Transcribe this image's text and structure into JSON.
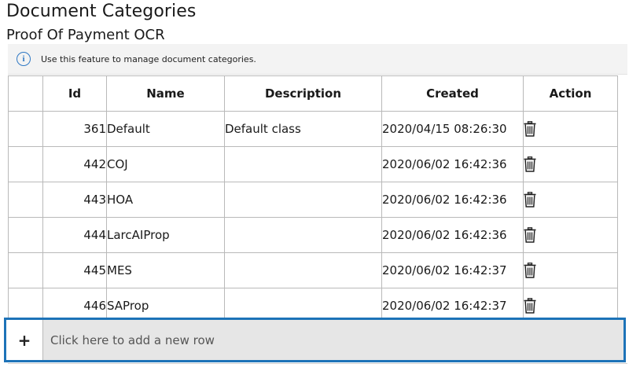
{
  "page": {
    "title": "Document Categories",
    "subtitle": "Proof Of Payment OCR"
  },
  "info": {
    "icon": "info-icon",
    "text": "Use this feature to manage document categories."
  },
  "table": {
    "columns": [
      "",
      "Id",
      "Name",
      "Description",
      "Created",
      "Action"
    ],
    "rows": [
      {
        "id": "361",
        "name": "Default",
        "description": "Default class",
        "created": "2020/04/15 08:26:30",
        "action_icon": "trash-icon"
      },
      {
        "id": "442",
        "name": "COJ",
        "description": "",
        "created": "2020/06/02 16:42:36",
        "action_icon": "trash-icon"
      },
      {
        "id": "443",
        "name": "HOA",
        "description": "",
        "created": "2020/06/02 16:42:36",
        "action_icon": "trash-icon"
      },
      {
        "id": "444",
        "name": "LarcAIProp",
        "description": "",
        "created": "2020/06/02 16:42:36",
        "action_icon": "trash-icon"
      },
      {
        "id": "445",
        "name": "MES",
        "description": "",
        "created": "2020/06/02 16:42:37",
        "action_icon": "trash-icon"
      },
      {
        "id": "446",
        "name": "SAProp",
        "description": "",
        "created": "2020/06/02 16:42:37",
        "action_icon": "trash-icon"
      }
    ]
  },
  "new_row": {
    "plus": "+",
    "text": "Click here to add a new row",
    "highlight_color": "#1d73b8"
  }
}
